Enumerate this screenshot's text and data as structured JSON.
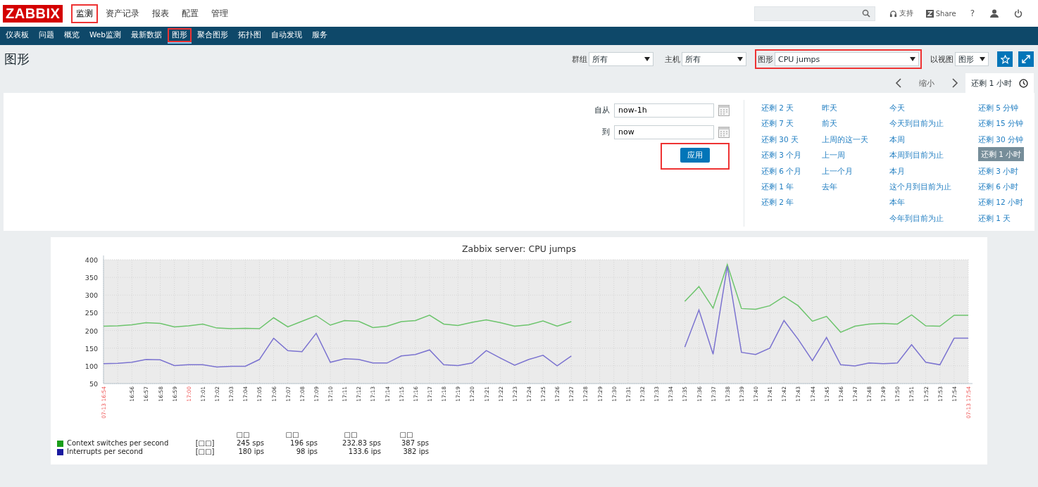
{
  "header": {
    "logo": "ZABBIX",
    "menu": [
      {
        "label": "监测",
        "selected": true,
        "highlighted": true
      },
      {
        "label": "资产记录",
        "selected": false,
        "highlighted": false
      },
      {
        "label": "报表",
        "selected": false,
        "highlighted": false
      },
      {
        "label": "配置",
        "selected": false,
        "highlighted": false
      },
      {
        "label": "管理",
        "selected": false,
        "highlighted": false
      }
    ],
    "support": "支持",
    "share": "Share",
    "help": "?"
  },
  "nav": [
    {
      "label": "仪表板",
      "selected": false,
      "highlighted": false
    },
    {
      "label": "问题",
      "selected": false,
      "highlighted": false
    },
    {
      "label": "概览",
      "selected": false,
      "highlighted": false
    },
    {
      "label": "Web监测",
      "selected": false,
      "highlighted": false
    },
    {
      "label": "最新数据",
      "selected": false,
      "highlighted": false
    },
    {
      "label": "图形",
      "selected": true,
      "highlighted": true
    },
    {
      "label": "聚合图形",
      "selected": false,
      "highlighted": false
    },
    {
      "label": "拓扑图",
      "selected": false,
      "highlighted": false
    },
    {
      "label": "自动发现",
      "selected": false,
      "highlighted": false
    },
    {
      "label": "服务",
      "selected": false,
      "highlighted": false
    }
  ],
  "page_title": "图形",
  "filters": [
    {
      "label": "群组",
      "value": "所有",
      "highlighted": false
    },
    {
      "label": "主机",
      "value": "所有",
      "highlighted": false
    },
    {
      "label": "图形",
      "value": "CPU jumps",
      "highlighted": true
    },
    {
      "label": "以视图",
      "value": "图形",
      "highlighted": false
    }
  ],
  "time_nav": {
    "zoom_out": "缩小",
    "tab": "还剩 1 小时"
  },
  "time_form": {
    "from_label": "自从",
    "from": "now-1h",
    "to_label": "到",
    "to": "now",
    "apply": "应用",
    "apply_highlighted": true
  },
  "quick_ranges": [
    [
      {
        "label": "还剩 2 天",
        "selected": false
      },
      {
        "label": "还剩 7 天",
        "selected": false
      },
      {
        "label": "还剩 30 天",
        "selected": false
      },
      {
        "label": "还剩 3 个月",
        "selected": false
      },
      {
        "label": "还剩 6 个月",
        "selected": false
      },
      {
        "label": "还剩 1 年",
        "selected": false
      },
      {
        "label": "还剩 2 年",
        "selected": false
      }
    ],
    [
      {
        "label": "昨天",
        "selected": false
      },
      {
        "label": "前天",
        "selected": false
      },
      {
        "label": "上周的这一天",
        "selected": false
      },
      {
        "label": "上一周",
        "selected": false
      },
      {
        "label": "上一个月",
        "selected": false
      },
      {
        "label": "去年",
        "selected": false
      }
    ],
    [
      {
        "label": "今天",
        "selected": false
      },
      {
        "label": "今天到目前为止",
        "selected": false
      },
      {
        "label": "本周",
        "selected": false
      },
      {
        "label": "本周到目前为止",
        "selected": false
      },
      {
        "label": "本月",
        "selected": false
      },
      {
        "label": "这个月到目前为止",
        "selected": false
      },
      {
        "label": "本年",
        "selected": false
      },
      {
        "label": "今年到目前为止",
        "selected": false
      }
    ],
    [
      {
        "label": "还剩 5 分钟",
        "selected": false
      },
      {
        "label": "还剩 15 分钟",
        "selected": false
      },
      {
        "label": "还剩 30 分钟",
        "selected": false
      },
      {
        "label": "还剩 1 小时",
        "selected": true
      },
      {
        "label": "还剩 3 小时",
        "selected": false
      },
      {
        "label": "还剩 6 小时",
        "selected": false
      },
      {
        "label": "还剩 12 小时",
        "selected": false
      },
      {
        "label": "还剩 1 天",
        "selected": false
      }
    ]
  ],
  "graph": {
    "chart_data": {
      "type": "line",
      "title": "Zabbix server: CPU jumps",
      "grid": true,
      "ylim": [
        50,
        400
      ],
      "yticks": [
        50,
        100,
        150,
        200,
        250,
        300,
        350,
        400
      ],
      "categories": [
        "07-13 16:54",
        null,
        "16:56",
        "16:57",
        "16:58",
        "16:59",
        "17:00",
        "17:01",
        "17:02",
        "17:03",
        "17:04",
        "17:05",
        "17:06",
        "17:07",
        "17:08",
        "17:09",
        "17:10",
        "17:11",
        "17:12",
        "17:13",
        "17:14",
        "17:15",
        "17:16",
        "17:17",
        "17:18",
        "17:19",
        "17:20",
        "17:21",
        "17:22",
        "17:23",
        "17:24",
        "17:25",
        "17:26",
        "17:27",
        "17:28",
        "17:29",
        "17:30",
        "17:31",
        "17:32",
        "17:33",
        "17:34",
        "17:35",
        "17:36",
        "17:37",
        "17:38",
        "17:39",
        "17:40",
        "17:41",
        "17:42",
        "17:43",
        "17:44",
        "17:45",
        "17:46",
        "17:47",
        "17:48",
        "17:49",
        "17:50",
        "17:51",
        "17:52",
        "17:53",
        "17:54",
        "07-13 17:54"
      ],
      "series": [
        {
          "name": "Context switches per second",
          "color": "#6cc46c",
          "values": [
            212,
            213,
            216,
            222,
            220,
            210,
            213,
            218,
            207,
            205,
            206,
            205,
            236,
            210,
            226,
            242,
            215,
            228,
            226,
            208,
            212,
            225,
            228,
            243,
            218,
            214,
            223,
            230,
            222,
            212,
            216,
            227,
            212,
            225,
            null,
            null,
            null,
            null,
            null,
            null,
            null,
            282,
            324,
            263,
            386,
            262,
            260,
            270,
            296,
            270,
            226,
            240,
            195,
            212,
            218,
            220,
            218,
            244,
            213,
            212,
            243,
            243
          ]
        },
        {
          "name": "Interrupts per second",
          "color": "#7b73d0",
          "values": [
            106,
            107,
            110,
            118,
            117,
            101,
            103,
            103,
            97,
            99,
            99,
            118,
            178,
            143,
            140,
            192,
            110,
            120,
            118,
            108,
            108,
            128,
            132,
            145,
            103,
            101,
            108,
            143,
            122,
            102,
            118,
            130,
            100,
            128,
            null,
            null,
            null,
            null,
            null,
            null,
            null,
            153,
            258,
            133,
            382,
            138,
            132,
            150,
            228,
            175,
            115,
            180,
            103,
            100,
            108,
            106,
            108,
            160,
            110,
            103,
            178,
            178
          ]
        }
      ]
    },
    "legend": {
      "headers": [
        "□□",
        "□□",
        "□□",
        "□□"
      ],
      "rows": [
        {
          "color": "#1a9e1a",
          "func": "[□□]",
          "values": [
            "245 sps",
            "196 sps",
            "232.83 sps",
            "387 sps"
          ]
        },
        {
          "color": "#1a1aa0",
          "func": "[□□]",
          "values": [
            "180 ips",
            "98 ips",
            "133.6 ips",
            "382 ips"
          ]
        }
      ]
    }
  }
}
